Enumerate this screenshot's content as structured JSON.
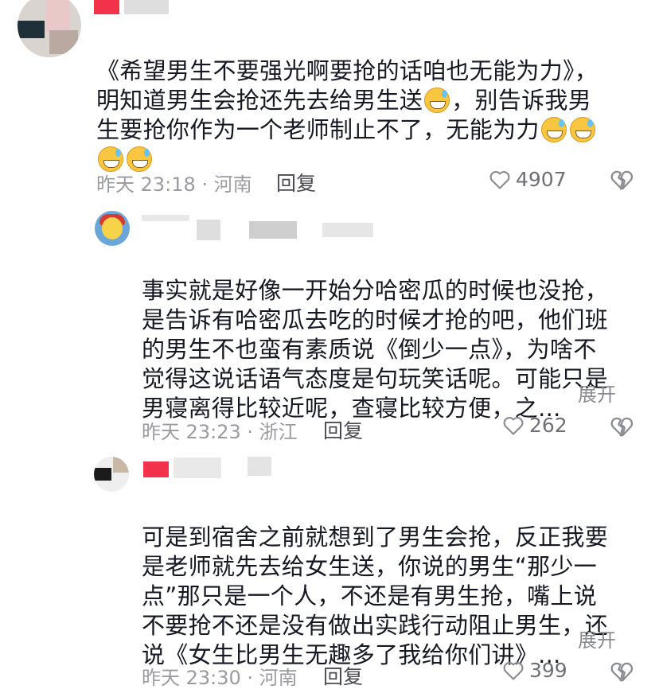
{
  "comments": [
    {
      "lines": [
        "《希望男生不要强光啊要抢的话咱也无能为力》，",
        "明知道男生会抢还先去给男生送",
        "，别告诉我男",
        "生要抢你作为一个老师制止不了，无能为力"
      ],
      "time": "昨天 23:18 · 河南",
      "reply": "回复",
      "likes": "4907",
      "emoji": "grinning-sweat-emoji"
    },
    {
      "lines": [
        "事实就是好像一开始分哈密瓜的时候也没抢，",
        "是告诉有哈密瓜去吃的时候才抢的吧，他们班",
        "的男生不也蛮有素质说《倒少一点》，为啥不",
        "觉得这说话语气态度是句玩笑话呢。可能只是",
        "男寝离得比较近呢，查寝比较方便，之..."
      ],
      "expand": "展开",
      "time": "昨天 23:23 · 浙江",
      "reply": "回复",
      "likes": "262"
    },
    {
      "lines": [
        "可是到宿舍之前就想到了男生会抢，反正我要",
        "是老师就先去给女生送，你说的男生“那少一",
        "点”那只是一个人，不还是有男生抢，嘴上说",
        "不要抢不还是没有做出实践行动阻止男生，还",
        "说《女生比男生无趣多了我给你们讲》..."
      ],
      "expand": "展开",
      "time": "昨天 23:30 · 河南",
      "reply": "回复",
      "likes": "399"
    }
  ]
}
